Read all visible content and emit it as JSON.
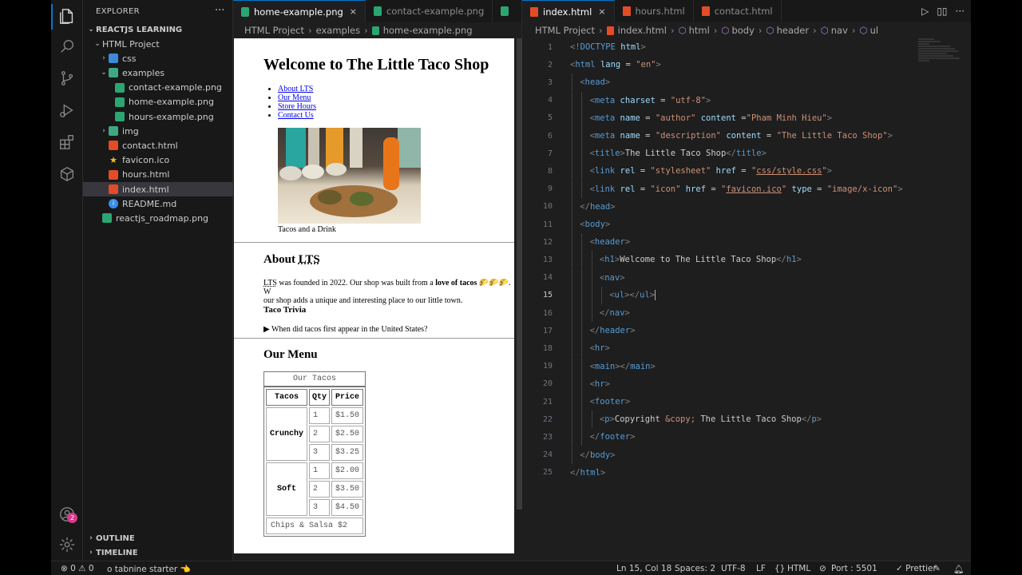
{
  "sidebar": {
    "title": "EXPLORER",
    "more": "···",
    "workspace": "REACTJS LEARNING",
    "tree": [
      {
        "label": "HTML Project",
        "type": "folder-open",
        "depth": 1
      },
      {
        "label": "css",
        "type": "folder",
        "depth": 2
      },
      {
        "label": "examples",
        "type": "folder-open-green",
        "depth": 2
      },
      {
        "label": "contact-example.png",
        "type": "image",
        "depth": 3
      },
      {
        "label": "home-example.png",
        "type": "image",
        "depth": 3
      },
      {
        "label": "hours-example.png",
        "type": "image",
        "depth": 3
      },
      {
        "label": "img",
        "type": "folder-green",
        "depth": 2
      },
      {
        "label": "contact.html",
        "type": "html",
        "depth": 2
      },
      {
        "label": "favicon.ico",
        "type": "ico",
        "depth": 2
      },
      {
        "label": "hours.html",
        "type": "html",
        "depth": 2
      },
      {
        "label": "index.html",
        "type": "html",
        "depth": 2,
        "selected": true
      },
      {
        "label": "README.md",
        "type": "md",
        "depth": 2
      },
      {
        "label": "reactjs_roadmap.png",
        "type": "image",
        "depth": 1
      }
    ],
    "outline": "OUTLINE",
    "timeline": "TIMELINE",
    "accounts_badge": "2"
  },
  "left_group": {
    "tabs": [
      {
        "label": "home-example.png",
        "active": true,
        "close": "×"
      },
      {
        "label": "contact-example.png",
        "active": false
      },
      {
        "label": "",
        "active": false
      }
    ],
    "more": "···",
    "breadcrumb": [
      "HTML Project",
      "examples",
      "home-example.png"
    ]
  },
  "preview_page": {
    "title": "Welcome to The Little Taco Shop",
    "nav": [
      "About LTS",
      "Our Menu",
      "Store Hours",
      "Contact Us"
    ],
    "caption": "Tacos and a Drink",
    "about_heading_prefix": "About ",
    "about_heading_abbr": "LTS",
    "about_abbr": "LTS",
    "about_p1": " was founded in 2022. Our shop was built from a ",
    "about_bold": "love of tacos",
    "about_emoji": " 🌮🌮🌮. W",
    "about_p2": "our shop adds a unique and interesting place to our little town.",
    "trivia_heading": "Taco Trivia",
    "trivia_question": "When did tacos first appear in the United States?",
    "menu_heading": "Our Menu",
    "menu_caption": "Our Tacos",
    "menu_headers": [
      "Tacos",
      "Qty",
      "Price"
    ],
    "menu_groups": [
      {
        "name": "Crunchy",
        "rows": [
          [
            "1",
            "$1.50"
          ],
          [
            "2",
            "$2.50"
          ],
          [
            "3",
            "$3.25"
          ]
        ]
      },
      {
        "name": "Soft",
        "rows": [
          [
            "1",
            "$2.00"
          ],
          [
            "2",
            "$3.50"
          ],
          [
            "3",
            "$4.50"
          ]
        ]
      }
    ],
    "menu_footer": "Chips & Salsa $2"
  },
  "right_group": {
    "tabs": [
      {
        "label": "index.html",
        "active": true,
        "close": "×"
      },
      {
        "label": "hours.html",
        "active": false
      },
      {
        "label": "contact.html",
        "active": false
      }
    ],
    "breadcrumb": [
      "HTML Project",
      "index.html",
      "html",
      "body",
      "header",
      "nav",
      "ul"
    ],
    "actions": [
      "▷",
      "▯▯",
      "···"
    ],
    "current_line": 15,
    "lines": [
      {
        "n": "1",
        "indent": 0,
        "tokens": [
          [
            "pu",
            "<!"
          ],
          [
            "tg",
            "DOCTYPE"
          ],
          [
            "tx",
            " "
          ],
          [
            "at",
            "html"
          ],
          [
            "pu",
            ">"
          ]
        ]
      },
      {
        "n": "2",
        "indent": 0,
        "tokens": [
          [
            "pu",
            "<"
          ],
          [
            "tg",
            "html"
          ],
          [
            "tx",
            " "
          ],
          [
            "at",
            "lang"
          ],
          [
            "tx",
            " = "
          ],
          [
            "st",
            "\"en\""
          ],
          [
            "pu",
            ">"
          ]
        ]
      },
      {
        "n": "3",
        "indent": 1,
        "tokens": [
          [
            "pu",
            "<"
          ],
          [
            "tg",
            "head"
          ],
          [
            "pu",
            ">"
          ]
        ]
      },
      {
        "n": "4",
        "indent": 2,
        "tokens": [
          [
            "pu",
            "<"
          ],
          [
            "tg",
            "meta"
          ],
          [
            "tx",
            " "
          ],
          [
            "at",
            "charset"
          ],
          [
            "tx",
            " = "
          ],
          [
            "st",
            "\"utf-8\""
          ],
          [
            "pu",
            ">"
          ]
        ]
      },
      {
        "n": "5",
        "indent": 2,
        "tokens": [
          [
            "pu",
            "<"
          ],
          [
            "tg",
            "meta"
          ],
          [
            "tx",
            " "
          ],
          [
            "at",
            "name"
          ],
          [
            "tx",
            " = "
          ],
          [
            "st",
            "\"author\""
          ],
          [
            "tx",
            " "
          ],
          [
            "at",
            "content"
          ],
          [
            "tx",
            " ="
          ],
          [
            "st",
            "\"Pham Minh Hieu\""
          ],
          [
            "pu",
            ">"
          ]
        ]
      },
      {
        "n": "6",
        "indent": 2,
        "tokens": [
          [
            "pu",
            "<"
          ],
          [
            "tg",
            "meta"
          ],
          [
            "tx",
            " "
          ],
          [
            "at",
            "name"
          ],
          [
            "tx",
            " = "
          ],
          [
            "st",
            "\"description\""
          ],
          [
            "tx",
            " "
          ],
          [
            "at",
            "content"
          ],
          [
            "tx",
            " = "
          ],
          [
            "st",
            "\"The Little Taco Shop\""
          ],
          [
            "pu",
            ">"
          ]
        ]
      },
      {
        "n": "7",
        "indent": 2,
        "tokens": [
          [
            "pu",
            "<"
          ],
          [
            "tg",
            "title"
          ],
          [
            "pu",
            ">"
          ],
          [
            "tx",
            "The Little Taco Shop"
          ],
          [
            "pu",
            "</"
          ],
          [
            "tg",
            "title"
          ],
          [
            "pu",
            ">"
          ]
        ]
      },
      {
        "n": "8",
        "indent": 2,
        "tokens": [
          [
            "pu",
            "<"
          ],
          [
            "tg",
            "link"
          ],
          [
            "tx",
            " "
          ],
          [
            "at",
            "rel"
          ],
          [
            "tx",
            " = "
          ],
          [
            "st",
            "\"stylesheet\""
          ],
          [
            "tx",
            " "
          ],
          [
            "at",
            "href"
          ],
          [
            "tx",
            " = "
          ],
          [
            "st",
            "\""
          ],
          [
            "lk",
            "css/style.css"
          ],
          [
            "st",
            "\""
          ],
          [
            "pu",
            ">"
          ]
        ]
      },
      {
        "n": "9",
        "indent": 2,
        "tokens": [
          [
            "pu",
            "<"
          ],
          [
            "tg",
            "link"
          ],
          [
            "tx",
            " "
          ],
          [
            "at",
            "rel"
          ],
          [
            "tx",
            " = "
          ],
          [
            "st",
            "\"icon\""
          ],
          [
            "tx",
            " "
          ],
          [
            "at",
            "href"
          ],
          [
            "tx",
            " = "
          ],
          [
            "st",
            "\""
          ],
          [
            "lk",
            "favicon.ico"
          ],
          [
            "st",
            "\""
          ],
          [
            "tx",
            " "
          ],
          [
            "at",
            "type"
          ],
          [
            "tx",
            " = "
          ],
          [
            "st",
            "\"image/x-icon\""
          ],
          [
            "pu",
            ">"
          ]
        ]
      },
      {
        "n": "10",
        "indent": 1,
        "tokens": [
          [
            "pu",
            "</"
          ],
          [
            "tg",
            "head"
          ],
          [
            "pu",
            ">"
          ]
        ]
      },
      {
        "n": "11",
        "indent": 1,
        "tokens": [
          [
            "pu",
            "<"
          ],
          [
            "tg",
            "body"
          ],
          [
            "pu",
            ">"
          ]
        ]
      },
      {
        "n": "12",
        "indent": 2,
        "tokens": [
          [
            "pu",
            "<"
          ],
          [
            "tg",
            "header"
          ],
          [
            "pu",
            ">"
          ]
        ]
      },
      {
        "n": "13",
        "indent": 3,
        "tokens": [
          [
            "pu",
            "<"
          ],
          [
            "tg",
            "h1"
          ],
          [
            "pu",
            ">"
          ],
          [
            "tx",
            "Welcome to The Little Taco Shop"
          ],
          [
            "pu",
            "</"
          ],
          [
            "tg",
            "h1"
          ],
          [
            "pu",
            ">"
          ]
        ]
      },
      {
        "n": "14",
        "indent": 3,
        "tokens": [
          [
            "pu",
            "<"
          ],
          [
            "tg",
            "nav"
          ],
          [
            "pu",
            ">"
          ]
        ]
      },
      {
        "n": "15",
        "indent": 4,
        "tokens": [
          [
            "pu",
            "<"
          ],
          [
            "tg",
            "ul"
          ],
          [
            "pu",
            "></"
          ],
          [
            "tg",
            "ul"
          ],
          [
            "pu",
            ">"
          ]
        ],
        "cursor": true
      },
      {
        "n": "16",
        "indent": 3,
        "tokens": [
          [
            "pu",
            "</"
          ],
          [
            "tg",
            "nav"
          ],
          [
            "pu",
            ">"
          ]
        ]
      },
      {
        "n": "17",
        "indent": 2,
        "tokens": [
          [
            "pu",
            "</"
          ],
          [
            "tg",
            "header"
          ],
          [
            "pu",
            ">"
          ]
        ]
      },
      {
        "n": "18",
        "indent": 2,
        "tokens": [
          [
            "pu",
            "<"
          ],
          [
            "tg",
            "hr"
          ],
          [
            "pu",
            ">"
          ]
        ]
      },
      {
        "n": "19",
        "indent": 2,
        "tokens": [
          [
            "pu",
            "<"
          ],
          [
            "tg",
            "main"
          ],
          [
            "pu",
            "></"
          ],
          [
            "tg",
            "main"
          ],
          [
            "pu",
            ">"
          ]
        ]
      },
      {
        "n": "20",
        "indent": 2,
        "tokens": [
          [
            "pu",
            "<"
          ],
          [
            "tg",
            "hr"
          ],
          [
            "pu",
            ">"
          ]
        ]
      },
      {
        "n": "21",
        "indent": 2,
        "tokens": [
          [
            "pu",
            "<"
          ],
          [
            "tg",
            "footer"
          ],
          [
            "pu",
            ">"
          ]
        ]
      },
      {
        "n": "22",
        "indent": 3,
        "tokens": [
          [
            "pu",
            "<"
          ],
          [
            "tg",
            "p"
          ],
          [
            "pu",
            ">"
          ],
          [
            "tx",
            "Copyright "
          ],
          [
            "st",
            "&copy;"
          ],
          [
            "tx",
            " The Little Taco Shop"
          ],
          [
            "pu",
            "</"
          ],
          [
            "tg",
            "p"
          ],
          [
            "pu",
            ">"
          ]
        ]
      },
      {
        "n": "23",
        "indent": 2,
        "tokens": [
          [
            "pu",
            "</"
          ],
          [
            "tg",
            "footer"
          ],
          [
            "pu",
            ">"
          ]
        ]
      },
      {
        "n": "24",
        "indent": 1,
        "tokens": [
          [
            "pu",
            "</"
          ],
          [
            "tg",
            "body"
          ],
          [
            "pu",
            ">"
          ]
        ]
      },
      {
        "n": "25",
        "indent": 0,
        "tokens": [
          [
            "pu",
            "</"
          ],
          [
            "tg",
            "html"
          ],
          [
            "pu",
            ">"
          ]
        ]
      }
    ]
  },
  "statusbar": {
    "problems": "⊗ 0 ⚠ 0",
    "tabnine": "o tabnine starter 👈",
    "position": "Ln 15, Col 18",
    "spaces": "Spaces: 2",
    "encoding": "UTF-8",
    "eol": "LF",
    "language": "HTML",
    "port": "Port : 5501",
    "prettier": "✓ Prettier"
  },
  "colors": {
    "accent": "#0078d4",
    "badge": "#d73a8b",
    "html_icon": "#e34c26",
    "image_icon": "#2ba673"
  }
}
